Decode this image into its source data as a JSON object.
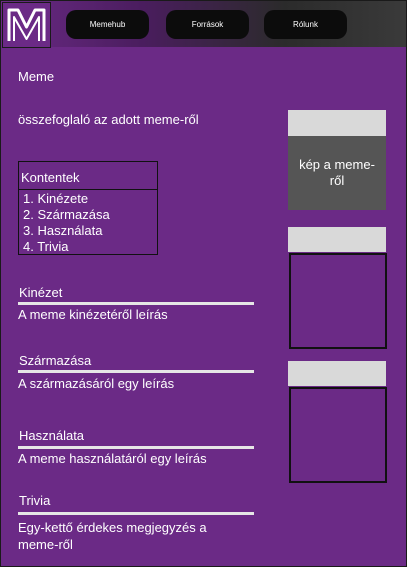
{
  "nav": {
    "items": [
      "Memehub",
      "Források",
      "Rólunk"
    ]
  },
  "main": {
    "title": "Meme",
    "summary": "összefoglaló az adott meme-ről",
    "toc": {
      "heading": "Kontentek",
      "items": [
        "1. Kinézete",
        "2. Származása",
        "3. Használata",
        "4. Trivia"
      ]
    },
    "sections": [
      {
        "heading": "Kinézet",
        "body": "A meme kinézetéről leírás"
      },
      {
        "heading": "Származása",
        "body": "A származásáról egy leírás"
      },
      {
        "heading": "Használata",
        "body": "A meme használatáról egy leírás"
      },
      {
        "heading": "Trivia",
        "body_line1": "Egy-kettő érdekes megjegyzés a",
        "body_line2": "meme-ről"
      }
    ]
  },
  "side": {
    "image_label_line1": "kép a meme-",
    "image_label_line2": "ről"
  },
  "colors": {
    "background": "#6b2a86",
    "nav_button": "#0c0c0c",
    "placeholder_gray": "#555555",
    "placeholder_light": "#d9d9d9"
  },
  "icons": {
    "logo": "m-logo-icon"
  }
}
